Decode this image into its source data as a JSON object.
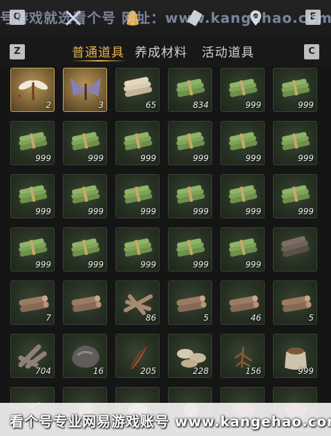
{
  "topbar": {
    "key_left": "Q",
    "key_right": "E",
    "watermark": "号游戏就选看个号 网址：www.kangehao.com",
    "icons": [
      "crossed-tools-icon",
      "bag-icon",
      "scroll-icon",
      "map-pin-icon"
    ]
  },
  "tabs": {
    "key_left": "Z",
    "key_right": "C",
    "items": [
      {
        "label": "普通道具",
        "active": true
      },
      {
        "label": "养成材料",
        "active": false
      },
      {
        "label": "活动道具",
        "active": false
      }
    ]
  },
  "items": [
    {
      "icon": "dragonfly-icon",
      "qty": "2",
      "rarity": "gold"
    },
    {
      "icon": "moth-icon",
      "qty": "3",
      "rarity": "gold"
    },
    {
      "icon": "log-bundle-icon",
      "qty": "65"
    },
    {
      "icon": "bamboo-bundle-icon",
      "qty": "834"
    },
    {
      "icon": "bamboo-bundle-icon",
      "qty": "999"
    },
    {
      "icon": "bamboo-bundle-icon",
      "qty": "999"
    },
    {
      "icon": "bamboo-bundle-icon",
      "qty": "999"
    },
    {
      "icon": "bamboo-bundle-icon",
      "qty": "999"
    },
    {
      "icon": "bamboo-bundle-icon",
      "qty": "999"
    },
    {
      "icon": "bamboo-bundle-icon",
      "qty": "999"
    },
    {
      "icon": "bamboo-bundle-icon",
      "qty": "999"
    },
    {
      "icon": "bamboo-bundle-icon",
      "qty": "999"
    },
    {
      "icon": "bamboo-bundle-icon",
      "qty": "999"
    },
    {
      "icon": "bamboo-bundle-icon",
      "qty": "999"
    },
    {
      "icon": "bamboo-bundle-icon",
      "qty": "999"
    },
    {
      "icon": "bamboo-bundle-icon",
      "qty": "999"
    },
    {
      "icon": "bamboo-bundle-icon",
      "qty": "999"
    },
    {
      "icon": "bamboo-bundle-icon",
      "qty": "999"
    },
    {
      "icon": "bamboo-bundle-icon",
      "qty": "999"
    },
    {
      "icon": "bamboo-bundle-icon",
      "qty": "999"
    },
    {
      "icon": "bamboo-bundle-icon",
      "qty": "999"
    },
    {
      "icon": "bamboo-bundle-icon",
      "qty": "999"
    },
    {
      "icon": "bamboo-bundle-icon",
      "qty": "999"
    },
    {
      "icon": "dark-log-bundle-icon",
      "qty": ""
    },
    {
      "icon": "wood-log-icon",
      "qty": "7"
    },
    {
      "icon": "wood-log-icon",
      "qty": ""
    },
    {
      "icon": "branch-pile-icon",
      "qty": "86"
    },
    {
      "icon": "wood-log-icon",
      "qty": "5"
    },
    {
      "icon": "wood-log-icon",
      "qty": "46"
    },
    {
      "icon": "wood-log-icon",
      "qty": "5"
    },
    {
      "icon": "charcoal-pile-icon",
      "qty": "704"
    },
    {
      "icon": "ore-rock-icon",
      "qty": "16"
    },
    {
      "icon": "feather-icon",
      "qty": "205"
    },
    {
      "icon": "mushroom-pile-icon",
      "qty": "228"
    },
    {
      "icon": "herb-root-icon",
      "qty": "156"
    },
    {
      "icon": "seed-sack-icon",
      "qty": "999"
    },
    {
      "icon": "plant-icon",
      "qty": ""
    },
    {
      "icon": "fruit-icon",
      "qty": ""
    },
    {
      "icon": "stone-icon",
      "qty": ""
    },
    {
      "icon": "fruit-icon",
      "qty": ""
    },
    {
      "icon": "meat-icon",
      "qty": ""
    },
    {
      "icon": "meat-icon",
      "qty": ""
    }
  ],
  "footer": {
    "watermark": "看个号专业网易游戏账号 www.kangehao.com"
  },
  "colors": {
    "active_tab": "#e7b24d",
    "cell_bg": "#263022",
    "gold_cell_bg": "#7e6538"
  }
}
